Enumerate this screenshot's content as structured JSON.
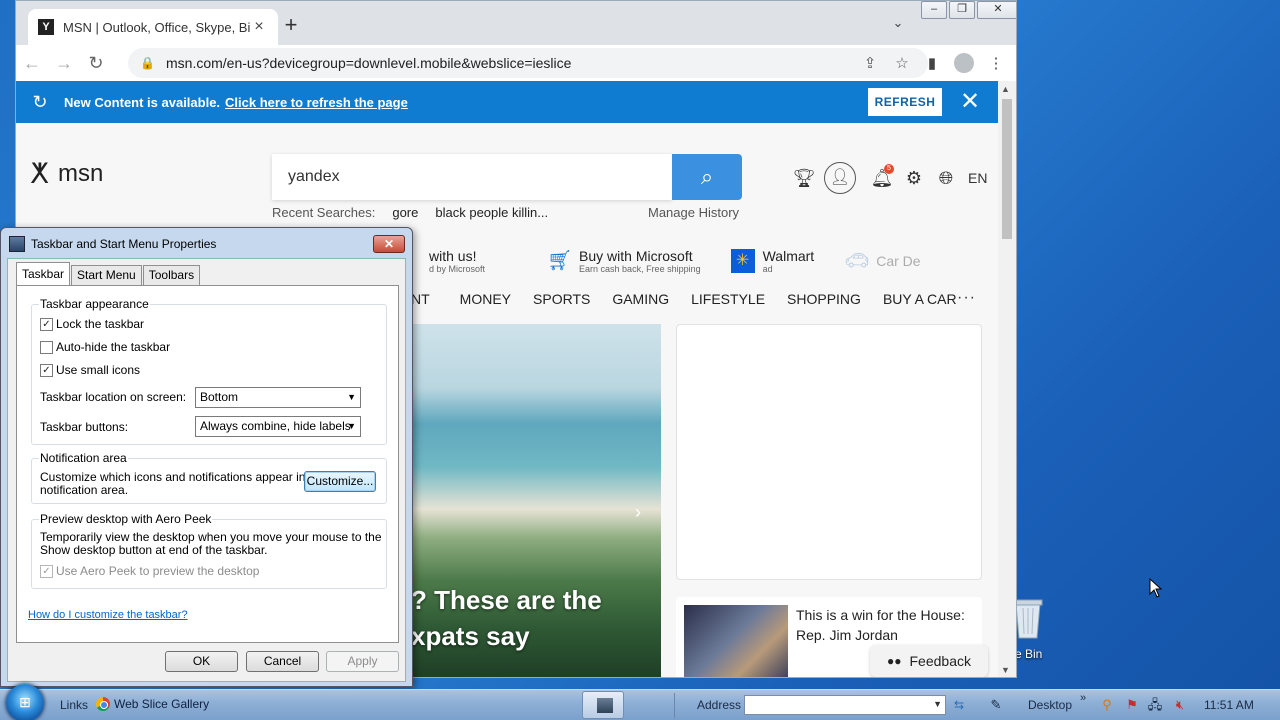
{
  "browser": {
    "tab_title": "MSN | Outlook, Office, Skype, Bing",
    "tab_favicon": "Y",
    "new_tab_glyph": "+",
    "url": "msn.com/en-us?devicegroup=downlevel.mobile&webslice=ieslice"
  },
  "banner": {
    "text": "New Content is available.",
    "link": "Click here to refresh the page",
    "button": "REFRESH"
  },
  "msn": {
    "logo_text": "msn",
    "search_value": "yandex",
    "recent_label": "Recent Searches:",
    "recent_items": [
      "gore",
      "black people killin..."
    ],
    "manage_history": "Manage History",
    "notification_count": "5",
    "language": "EN",
    "promos": [
      {
        "title": "with us!",
        "sub": "d by Microsoft"
      },
      {
        "title": "Buy with Microsoft",
        "sub": "Earn cash back, Free shipping"
      },
      {
        "title": "Walmart",
        "sub": "ad"
      },
      {
        "title": "Car De",
        "sub": ""
      }
    ],
    "nav": [
      "NT",
      "MONEY",
      "SPORTS",
      "GAMING",
      "LIFESTYLE",
      "SHOPPING",
      "BUY A CAR"
    ],
    "nav_more": "···",
    "hero_title_1": "? These are the",
    "hero_title_2": "xpats say",
    "news_title": "This is a win for the House: Rep. Jim Jordan",
    "feedback": "Feedback"
  },
  "dialog": {
    "title": "Taskbar and Start Menu Properties",
    "tabs": [
      "Taskbar",
      "Start Menu",
      "Toolbars"
    ],
    "appearance_title": "Taskbar appearance",
    "lock_taskbar": "Lock the taskbar",
    "auto_hide": "Auto-hide the taskbar",
    "small_icons": "Use small icons",
    "location_label": "Taskbar location on screen:",
    "location_value": "Bottom",
    "buttons_label": "Taskbar buttons:",
    "buttons_value": "Always combine, hide labels",
    "notification_title": "Notification area",
    "notification_text_1": "Customize which icons and notifications appear in the",
    "notification_text_2": "notification area.",
    "customize_button": "Customize...",
    "peek_title": "Preview desktop with Aero Peek",
    "peek_text_1": "Temporarily view the desktop when you move your mouse to the",
    "peek_text_2": "Show desktop button at end of the taskbar.",
    "peek_checkbox": "Use Aero Peek to preview the desktop",
    "help_link": "How do I customize the taskbar?",
    "ok": "OK",
    "cancel": "Cancel",
    "apply": "Apply",
    "checks": {
      "lock": "✓",
      "autohide": "",
      "small": "✓",
      "peek": "✓"
    }
  },
  "taskbar": {
    "links": "Links",
    "web_slice": "Web Slice Gallery",
    "address_label": "Address",
    "desktop": "Desktop",
    "chevron": "»",
    "clock": "11:51 AM"
  },
  "desktop": {
    "recycle_label": "e Bin"
  }
}
